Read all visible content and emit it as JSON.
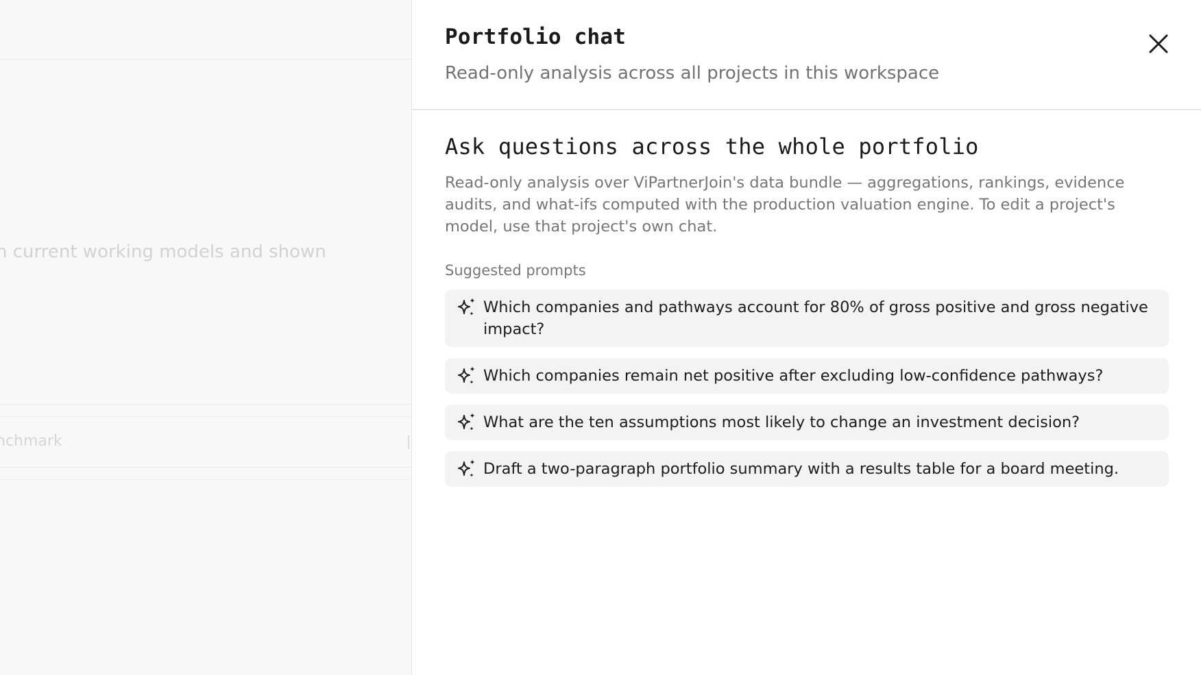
{
  "background": {
    "fragment_text": "n current working models and shown",
    "fragment_label": "nchmark"
  },
  "drawer": {
    "title": "Portfolio chat",
    "subtitle": "Read-only analysis across all projects in this workspace",
    "close_icon": "close-icon",
    "intro_heading": "Ask questions across the whole portfolio",
    "intro_text": "Read-only analysis over ViPartnerJoin's data bundle — aggregations, rankings, evidence audits, and what-ifs computed with the production valuation engine. To edit a project's model, use that project's own chat.",
    "prompts_label": "Suggested prompts",
    "prompt_icon": "sparkle-icon",
    "prompts": [
      {
        "text": "Which companies and pathways account for 80% of gross positive and gross negative impact?"
      },
      {
        "text": "Which companies remain net positive after excluding low-confidence pathways?"
      },
      {
        "text": "What are the ten assumptions most likely to change an investment decision?"
      },
      {
        "text": "Draft a two-paragraph portfolio summary with a results table for a board meeting."
      }
    ]
  }
}
